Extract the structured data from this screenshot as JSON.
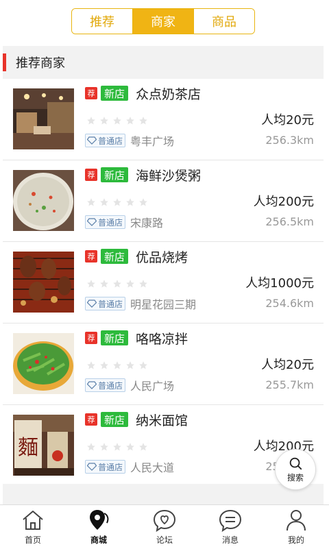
{
  "tabs": [
    {
      "label": "推荐",
      "active": false
    },
    {
      "label": "商家",
      "active": true
    },
    {
      "label": "商品",
      "active": false
    }
  ],
  "section": {
    "title": "推荐商家"
  },
  "badges": {
    "recommend": "荐",
    "new": "新店",
    "level": "普通店"
  },
  "shops": [
    {
      "name": "众点奶茶店",
      "price": "人均20元",
      "location": "粤丰广场",
      "distance": "256.3km",
      "rating": 0,
      "image": "restaurant-interior"
    },
    {
      "name": "海鲜沙煲粥",
      "price": "人均200元",
      "location": "宋康路",
      "distance": "256.5km",
      "rating": 0,
      "image": "seafood-porridge"
    },
    {
      "name": "优品烧烤",
      "price": "人均1000元",
      "location": "明星花园三期",
      "distance": "254.6km",
      "rating": 0,
      "image": "barbecue"
    },
    {
      "name": "咯咯凉拌",
      "price": "人均20元",
      "location": "人民广场",
      "distance": "255.7km",
      "rating": 0,
      "image": "cold-salad"
    },
    {
      "name": "纳米面馆",
      "price": "人均200元",
      "location": "人民大道",
      "distance": "255.9km",
      "rating": 0,
      "image": "noodle-shop"
    }
  ],
  "fab": {
    "label": "搜索",
    "icon": "search-icon"
  },
  "nav": [
    {
      "label": "首页",
      "icon": "home-icon",
      "active": false
    },
    {
      "label": "商城",
      "icon": "location-pin-icon",
      "active": true
    },
    {
      "label": "论坛",
      "icon": "heart-chat-icon",
      "active": false
    },
    {
      "label": "消息",
      "icon": "message-icon",
      "active": false
    },
    {
      "label": "我的",
      "icon": "user-icon",
      "active": false
    }
  ],
  "colors": {
    "accent": "#f0b414",
    "recommend_badge": "#e8332a",
    "new_badge": "#2dba3c"
  }
}
